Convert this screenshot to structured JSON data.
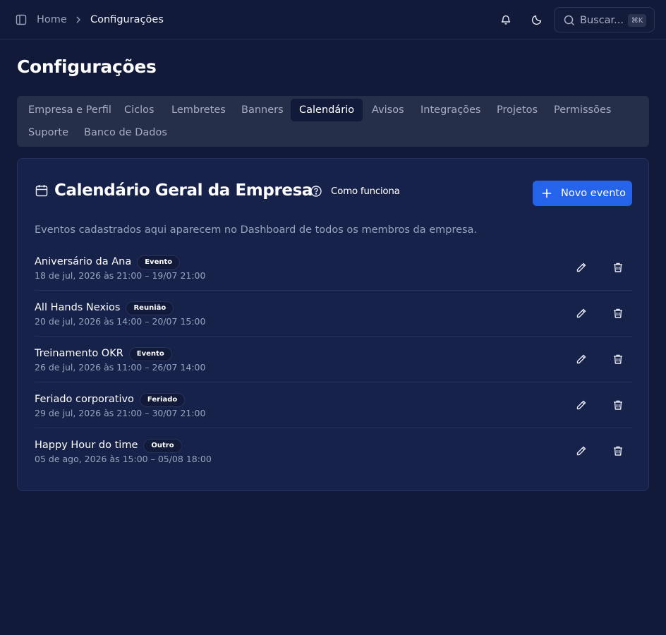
{
  "topbar": {
    "breadcrumb_home": "Home",
    "breadcrumb_current": "Configurações",
    "search_placeholder": "Buscar...",
    "search_shortcut": "⌘K",
    "icons": [
      "sidebar-toggle-icon",
      "chevron-right-icon",
      "bell-icon",
      "moon-icon",
      "search-icon"
    ]
  },
  "page": {
    "title": "Configurações"
  },
  "tabs": [
    {
      "label": "Empresa e Perfil",
      "active": false
    },
    {
      "label": "Ciclos",
      "active": false
    },
    {
      "label": "Lembretes",
      "active": false
    },
    {
      "label": "Banners",
      "active": false
    },
    {
      "label": "Calendário",
      "active": true
    },
    {
      "label": "Avisos",
      "active": false
    },
    {
      "label": "Integrações",
      "active": false
    },
    {
      "label": "Projetos",
      "active": false
    },
    {
      "label": "Permissões",
      "active": false
    },
    {
      "label": "Suporte",
      "active": false
    },
    {
      "label": "Banco de Dados",
      "active": false
    }
  ],
  "card": {
    "title": "Calendário Geral da Empresa",
    "help_label": "Como funciona",
    "new_button_label": "Novo evento",
    "description": "Eventos cadastrados aqui aparecem no Dashboard de todos os membros da empresa.",
    "events": [
      {
        "name": "Aniversário da Ana",
        "type": "Evento",
        "date": "18 de jul, 2026 às 21:00 – 19/07 21:00"
      },
      {
        "name": "All Hands Nexios",
        "type": "Reunião",
        "date": "20 de jul, 2026 às 14:00 – 20/07 15:00"
      },
      {
        "name": "Treinamento OKR",
        "type": "Evento",
        "date": "26 de jul, 2026 às 11:00 – 26/07 14:00"
      },
      {
        "name": "Feriado corporativo",
        "type": "Feriado",
        "date": "29 de jul, 2026 às 21:00 – 30/07 21:00"
      },
      {
        "name": "Happy Hour do time",
        "type": "Outro",
        "date": "05 de ago, 2026 às 15:00 – 05/08 18:00"
      }
    ]
  },
  "colors": {
    "background": "#111a38",
    "card": "#17224a",
    "tab_bar": "#252f49",
    "accent": "#2563eb",
    "muted_text": "#9aa3bd"
  }
}
